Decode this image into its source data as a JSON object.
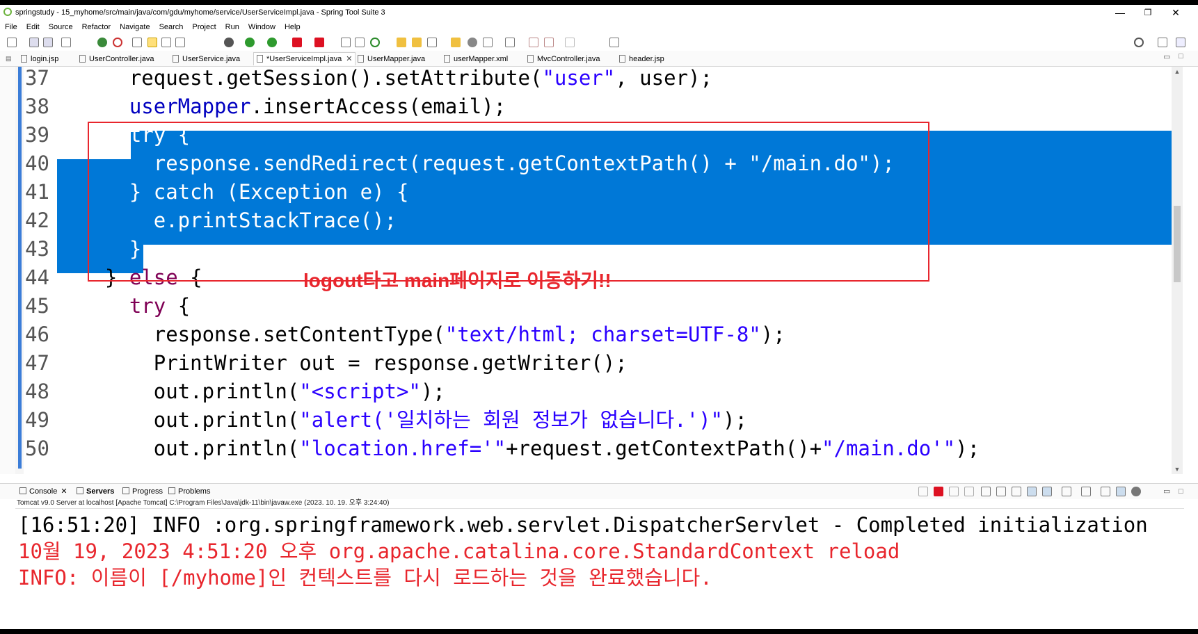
{
  "window": {
    "title": "springstudy - 15_myhome/src/main/java/com/gdu/myhome/service/UserServiceImpl.java - Spring Tool Suite 3",
    "minimize": "—",
    "restore": "❐",
    "close": "✕"
  },
  "menu": [
    "File",
    "Edit",
    "Source",
    "Refactor",
    "Navigate",
    "Search",
    "Project",
    "Run",
    "Window",
    "Help"
  ],
  "tabs": [
    {
      "label": "login.jsp",
      "icon": "jsp-file-icon"
    },
    {
      "label": "UserController.java",
      "icon": "java-file-icon"
    },
    {
      "label": "UserService.java",
      "icon": "java-file-icon"
    },
    {
      "label": "*UserServiceImpl.java",
      "icon": "java-file-icon",
      "active": true
    },
    {
      "label": "UserMapper.java",
      "icon": "java-file-icon"
    },
    {
      "label": "userMapper.xml",
      "icon": "xml-file-icon"
    },
    {
      "label": "MvcController.java",
      "icon": "java-file-icon"
    },
    {
      "label": "header.jsp",
      "icon": "jsp-file-icon"
    }
  ],
  "editor": {
    "lines": [
      {
        "num": "37",
        "text": "    request.getSession().setAttribute(\"user\", user);"
      },
      {
        "num": "38",
        "text": "    userMapper.insertAccess(email);"
      },
      {
        "num": "39",
        "text": "    try {"
      },
      {
        "num": "40",
        "text": "      response.sendRedirect(request.getContextPath() + \"/main.do\");"
      },
      {
        "num": "41",
        "text": "    } catch (Exception e) {"
      },
      {
        "num": "42",
        "text": "      e.printStackTrace();"
      },
      {
        "num": "43",
        "text": "    }"
      },
      {
        "num": "44",
        "text": "  } else {"
      },
      {
        "num": "45",
        "text": "    try {"
      },
      {
        "num": "46",
        "text": "      response.setContentType(\"text/html; charset=UTF-8\");"
      },
      {
        "num": "47",
        "text": "      PrintWriter out = response.getWriter();"
      },
      {
        "num": "48",
        "text": "      out.println(\"<script>\");"
      },
      {
        "num": "49",
        "text": "      out.println(\"alert('일치하는 회원 정보가 없습니다.')\");"
      },
      {
        "num": "50",
        "text": "      out.println(\"location.href='\"+request.getContextPath()+\"/main.do'\");"
      }
    ],
    "annotation": "logout타고 main페이지로 이동하기!!"
  },
  "bottom_tabs": [
    {
      "label": "Console",
      "closable": true
    },
    {
      "label": "Servers",
      "bold": true
    },
    {
      "label": "Progress"
    },
    {
      "label": "Problems"
    }
  ],
  "console": {
    "description": "Tomcat v9.0 Server at localhost [Apache Tomcat] C:\\Program Files\\Java\\jdk-11\\bin\\javaw.exe  (2023. 10. 19. 오후 3:24:40)",
    "lines": [
      {
        "text": "[16:51:20] INFO :org.springframework.web.servlet.DispatcherServlet - Completed initialization",
        "type": "info"
      },
      {
        "text": "10월 19, 2023 4:51:20 오후 org.apache.catalina.core.StandardContext reload",
        "type": "err"
      },
      {
        "text": "INFO: 이름이 [/myhome]인 컨텍스트를 다시 로드하는 것을 완료했습니다.",
        "type": "err"
      }
    ]
  },
  "colors": {
    "selection": "#0078d7",
    "annotation": "#e8262d",
    "keyword": "#7f0055",
    "field": "#0000c0",
    "string": "#2a00ff"
  }
}
